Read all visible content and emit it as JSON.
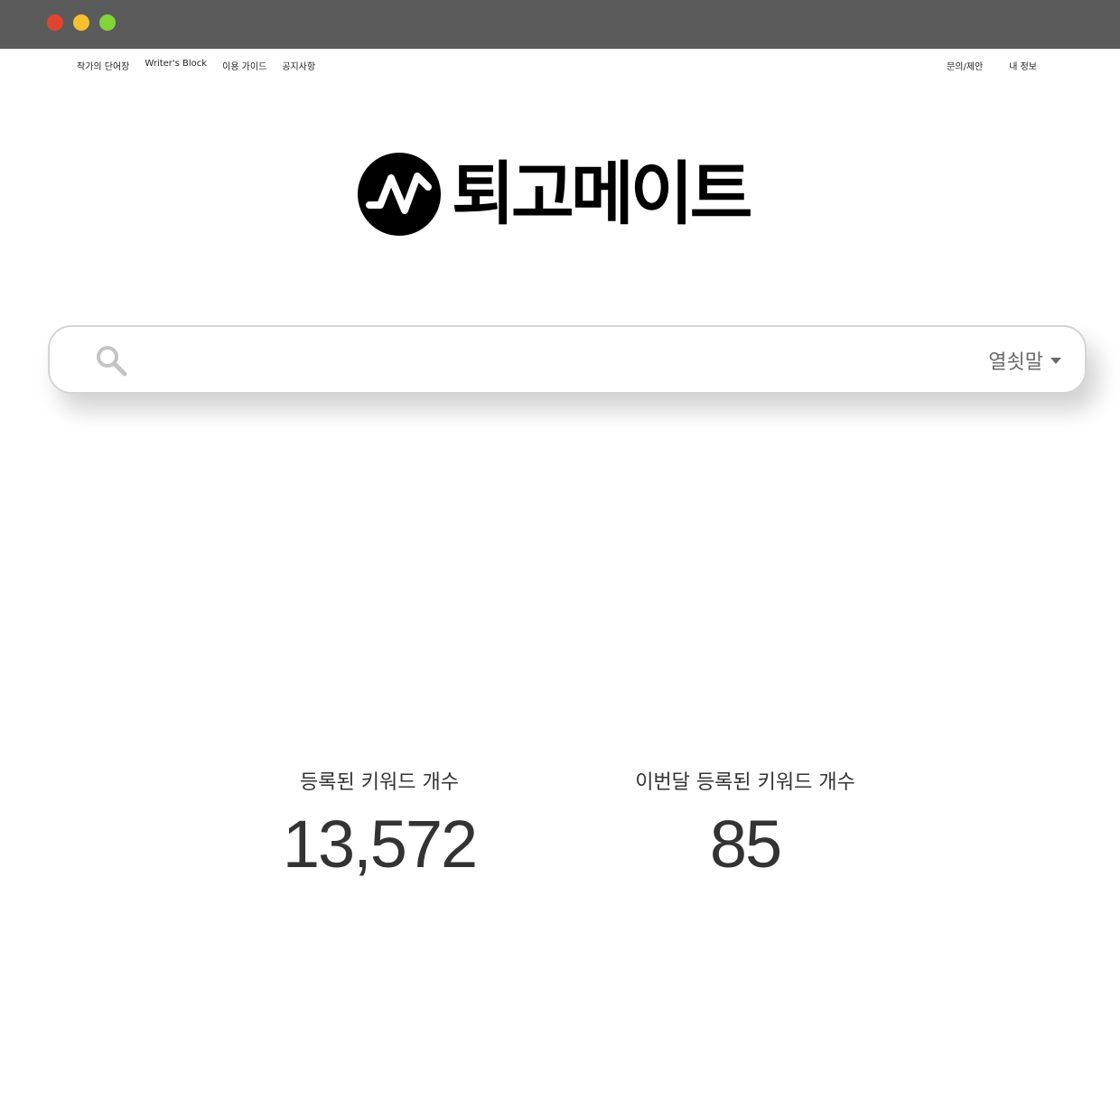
{
  "window": {
    "controls": [
      "close",
      "minimize",
      "maximize"
    ]
  },
  "nav": {
    "left": [
      "작가의 단어장",
      "Writer's Block",
      "이용 가이드",
      "공지사항"
    ],
    "right": [
      "문의/제안",
      "내 정보"
    ]
  },
  "logo": {
    "text": "퇴고메이트",
    "icon": "pulse-wave-icon"
  },
  "search": {
    "value": "",
    "placeholder": "",
    "icon": "search-icon",
    "mode_label": "열쇳말"
  },
  "stats": {
    "total_label": "등록된 키워드 개수",
    "total_value": "13,572",
    "month_label": "이번달 등록된 키워드 개수",
    "month_value": "85"
  },
  "colors": {
    "titlebar": "#5b5b5b",
    "close": "#e0442f",
    "minimize": "#f5c030",
    "maximize": "#7fd43a",
    "logo": "#000000",
    "text": "#333333"
  }
}
